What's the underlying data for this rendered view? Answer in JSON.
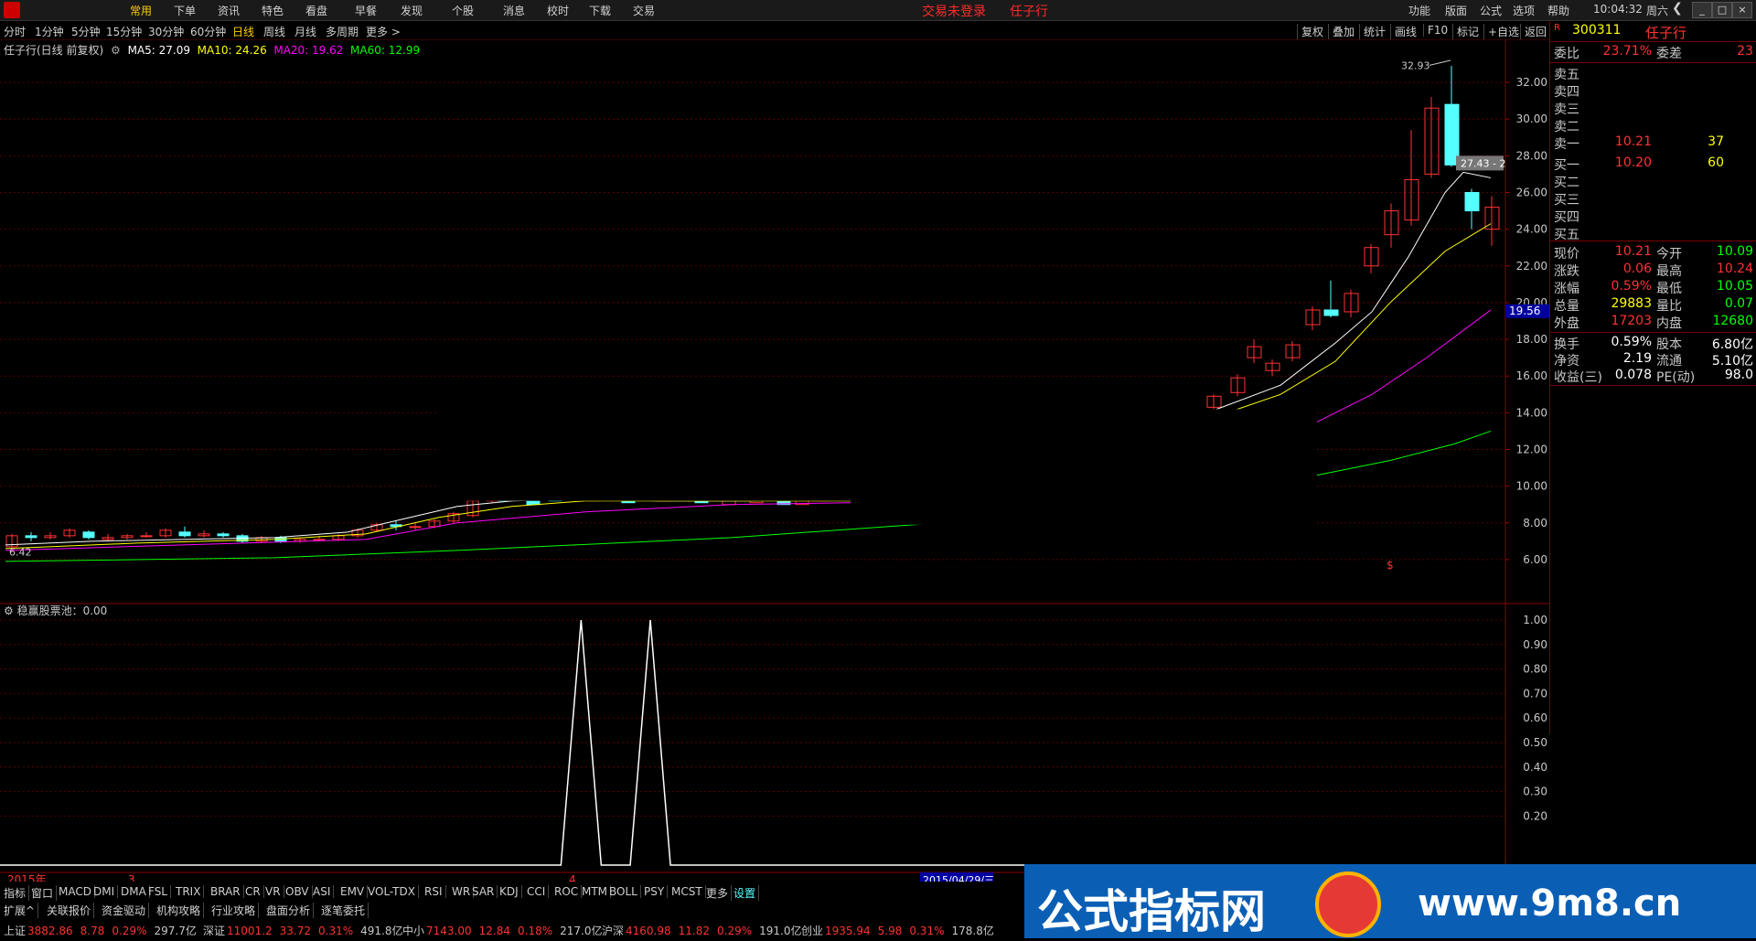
{
  "menubar": {
    "items": [
      "常用",
      "下单",
      "资讯",
      "特色",
      "看盘",
      "早餐",
      "发现",
      "个股",
      "消息",
      "校时",
      "下载",
      "交易"
    ],
    "active_index": 0,
    "notice": "交易未登录",
    "stock_name": "任子行",
    "right_items": [
      "功能",
      "版面",
      "公式",
      "选项",
      "帮助"
    ],
    "time": "10:04:32",
    "weekday": "周六"
  },
  "periodbar": {
    "periods": [
      "分时",
      "1分钟",
      "5分钟",
      "15分钟",
      "30分钟",
      "60分钟",
      "日线",
      "周线",
      "月线",
      "多周期",
      "更多 >"
    ],
    "selected_index": 6,
    "tools": [
      "复权",
      "叠加",
      "统计",
      "画线",
      "F10",
      "标记",
      "+自选",
      "返回"
    ]
  },
  "chart_info": {
    "title": "任子行(日线 前复权)",
    "ma5": "MA5: 27.09",
    "ma10": "MA10: 24.26",
    "ma20": "MA20: 19.62",
    "ma60": "MA60: 12.99",
    "high_label": "32.93",
    "low_label": "6.42",
    "cursor_label": "27.43 - 2",
    "price_tag": "19.56",
    "dollar_mark": "$",
    "colors": {
      "up": "#ff3232",
      "down": "#54ffff",
      "ma5": "#ffffff",
      "ma10": "#ffff00",
      "ma20": "#ff00ff",
      "ma60": "#00ff00"
    }
  },
  "main_axis": [
    "32.00",
    "30.00",
    "28.00",
    "26.00",
    "24.00",
    "22.00",
    "20.00",
    "18.00",
    "16.00",
    "14.00",
    "12.00",
    "10.00",
    "8.00",
    "6.00"
  ],
  "sub_chart": {
    "title": "稳赢股票池：0.00",
    "axis": [
      "1.00",
      "0.90",
      "0.80",
      "0.70",
      "0.60",
      "0.50",
      "0.40",
      "0.30",
      "0.20"
    ]
  },
  "date_axis": {
    "year": "2015年",
    "m3": "3",
    "m4": "4",
    "cursor_date": "2015/04/29/三"
  },
  "chart_data": {
    "type": "candlestick",
    "title": "任子行(日线 前复权)",
    "ylim": [
      5,
      33
    ],
    "candles": [
      {
        "o": 6.7,
        "c": 7.3,
        "h": 7.4,
        "l": 6.4
      },
      {
        "o": 7.3,
        "c": 7.2,
        "h": 7.5,
        "l": 7.0
      },
      {
        "o": 7.2,
        "c": 7.3,
        "h": 7.5,
        "l": 7.1
      },
      {
        "o": 7.3,
        "c": 7.6,
        "h": 7.7,
        "l": 7.2
      },
      {
        "o": 7.5,
        "c": 7.2,
        "h": 7.6,
        "l": 7.1
      },
      {
        "o": 7.1,
        "c": 7.2,
        "h": 7.4,
        "l": 7.0
      },
      {
        "o": 7.2,
        "c": 7.3,
        "h": 7.4,
        "l": 7.1
      },
      {
        "o": 7.3,
        "c": 7.3,
        "h": 7.5,
        "l": 7.2
      },
      {
        "o": 7.3,
        "c": 7.6,
        "h": 7.7,
        "l": 7.2
      },
      {
        "o": 7.5,
        "c": 7.3,
        "h": 7.8,
        "l": 7.2
      },
      {
        "o": 7.3,
        "c": 7.4,
        "h": 7.6,
        "l": 7.2
      },
      {
        "o": 7.4,
        "c": 7.3,
        "h": 7.5,
        "l": 7.2
      },
      {
        "o": 7.3,
        "c": 7.0,
        "h": 7.4,
        "l": 6.9
      },
      {
        "o": 7.0,
        "c": 7.2,
        "h": 7.3,
        "l": 6.9
      },
      {
        "o": 7.2,
        "c": 7.0,
        "h": 7.3,
        "l": 6.9
      },
      {
        "o": 7.0,
        "c": 7.1,
        "h": 7.2,
        "l": 6.9
      },
      {
        "o": 7.1,
        "c": 7.1,
        "h": 7.3,
        "l": 7.0
      },
      {
        "o": 7.1,
        "c": 7.3,
        "h": 7.4,
        "l": 7.0
      },
      {
        "o": 7.3,
        "c": 7.6,
        "h": 7.7,
        "l": 7.2
      },
      {
        "o": 7.6,
        "c": 7.9,
        "h": 8.0,
        "l": 7.5
      },
      {
        "o": 7.9,
        "c": 7.8,
        "h": 8.1,
        "l": 7.6
      },
      {
        "o": 7.8,
        "c": 7.8,
        "h": 8.0,
        "l": 7.6
      },
      {
        "o": 7.8,
        "c": 8.1,
        "h": 8.2,
        "l": 7.7
      },
      {
        "o": 8.1,
        "c": 8.5,
        "h": 8.6,
        "l": 8.0
      },
      {
        "o": 8.4,
        "c": 9.2,
        "h": 9.3,
        "l": 8.3
      },
      {
        "o": 9.2,
        "c": 9.9,
        "h": 10.0,
        "l": 9.1
      }
    ],
    "spikes_x_fraction": [
      0.386,
      0.432
    ],
    "sub_chart": {
      "series": "稳赢股票池",
      "ylim": [
        0,
        1
      ],
      "signal_values": [
        1,
        1
      ]
    }
  },
  "indicators": [
    "指标",
    "窗口",
    "MACD",
    "DMI",
    "DMA",
    "FSL",
    "TRIX",
    "BRAR",
    "CR",
    "VR",
    "OBV",
    "ASI",
    "EMV",
    "VOL-TDX",
    "RSI",
    "WR",
    "SAR",
    "KDJ",
    "CCI",
    "ROC",
    "MTM",
    "BOLL",
    "PSY",
    "MCST",
    "更多",
    "设置"
  ],
  "tabs": [
    "扩展^",
    "关联报价",
    "资金驱动",
    "机构攻略",
    "行业攻略",
    "盘面分析",
    "逐笔委托"
  ],
  "statusbar": [
    {
      "name": "上证",
      "value": "3882.86",
      "chg": "8.78",
      "pct": "0.29%",
      "amt": "297.7亿"
    },
    {
      "name": "深证",
      "value": "11001.2",
      "chg": "33.72",
      "pct": "0.31%",
      "amt": "491.8亿"
    },
    {
      "name": "中小",
      "value": "7143.00",
      "chg": "12.84",
      "pct": "0.18%",
      "amt": "217.0亿"
    },
    {
      "name": "沪深",
      "value": "4160.98",
      "chg": "11.82",
      "pct": "0.29%",
      "amt": "191.0亿"
    },
    {
      "name": "创业",
      "value": "1935.94",
      "chg": "5.98",
      "pct": "0.31%",
      "amt": "178.8亿"
    }
  ],
  "panel": {
    "code": "300311",
    "name": "任子行",
    "weibi_label": "委比",
    "weibi_val": "23.71%",
    "weicha_label": "委差",
    "weicha_val": "23",
    "sells": [
      {
        "label": "卖五",
        "price": "",
        "vol": ""
      },
      {
        "label": "卖四",
        "price": "",
        "vol": ""
      },
      {
        "label": "卖三",
        "price": "",
        "vol": ""
      },
      {
        "label": "卖二",
        "price": "",
        "vol": ""
      },
      {
        "label": "卖一",
        "price": "10.21",
        "vol": "37"
      }
    ],
    "buys": [
      {
        "label": "买一",
        "price": "10.20",
        "vol": "60"
      },
      {
        "label": "买二",
        "price": "",
        "vol": ""
      },
      {
        "label": "买三",
        "price": "",
        "vol": ""
      },
      {
        "label": "买四",
        "price": "",
        "vol": ""
      },
      {
        "label": "买五",
        "price": "",
        "vol": ""
      }
    ],
    "quote": [
      {
        "l1": "现价",
        "v1": "10.21",
        "c1": "#ff3232",
        "l2": "今开",
        "v2": "10.09",
        "c2": "#00ff00"
      },
      {
        "l1": "涨跌",
        "v1": "0.06",
        "c1": "#ff3232",
        "l2": "最高",
        "v2": "10.24",
        "c2": "#ff3232"
      },
      {
        "l1": "涨幅",
        "v1": "0.59%",
        "c1": "#ff3232",
        "l2": "最低",
        "v2": "10.05",
        "c2": "#00ff00"
      },
      {
        "l1": "总量",
        "v1": "29883",
        "c1": "#ffff00",
        "l2": "量比",
        "v2": "0.07",
        "c2": "#00ff00"
      },
      {
        "l1": "外盘",
        "v1": "17203",
        "c1": "#ff3232",
        "l2": "内盘",
        "v2": "12680",
        "c2": "#00ff00"
      }
    ],
    "fund": [
      {
        "l1": "换手",
        "v1": "0.59%",
        "l2": "股本",
        "v2": "6.80亿"
      },
      {
        "l1": "净资",
        "v1": "2.19",
        "l2": "流通",
        "v2": "5.10亿"
      },
      {
        "l1": "收益(三)",
        "v1": "0.078",
        "l2": "PE(动)",
        "v2": "98.0"
      }
    ]
  },
  "watermark": {
    "text": "公式指标网",
    "url": "www.9m8.cn"
  }
}
